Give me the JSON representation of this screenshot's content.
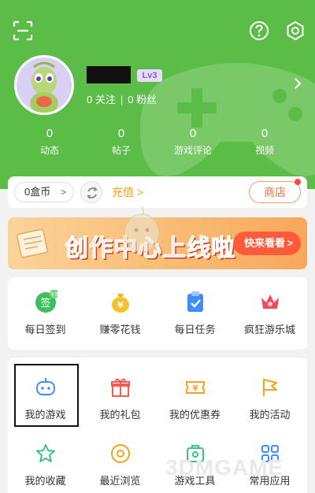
{
  "header": {
    "level": "Lv3",
    "follow": "0 关注",
    "fans": "0 粉丝",
    "stats": [
      {
        "num": "0",
        "label": "动态"
      },
      {
        "num": "0",
        "label": "帖子"
      },
      {
        "num": "0",
        "label": "游戏评论"
      },
      {
        "num": "0",
        "label": "视频"
      }
    ]
  },
  "coins": {
    "balance": "0盒币",
    "recharge": "充值",
    "shop": "商店"
  },
  "banner": {
    "title": "创作中心上线啦",
    "button": "快来看看"
  },
  "tasks": [
    {
      "label": "每日签到",
      "badge": "+5",
      "icon_text": "签"
    },
    {
      "label": "赚零花钱",
      "icon_text": "¥"
    },
    {
      "label": "每日任务"
    },
    {
      "label": "疯狂游乐城"
    }
  ],
  "grid": [
    {
      "label": "我的游戏"
    },
    {
      "label": "我的礼包"
    },
    {
      "label": "我的优惠券"
    },
    {
      "label": "我的活动"
    },
    {
      "label": "我的收藏"
    },
    {
      "label": "最近浏览"
    },
    {
      "label": "游戏工具"
    },
    {
      "label": "常用应用"
    }
  ],
  "watermark": "3DMGAME",
  "colors": {
    "header_green": "#5bbd47",
    "orange": "#f5a21b",
    "shop_border": "#f39b63",
    "banner_red": "#ff5b3a"
  }
}
